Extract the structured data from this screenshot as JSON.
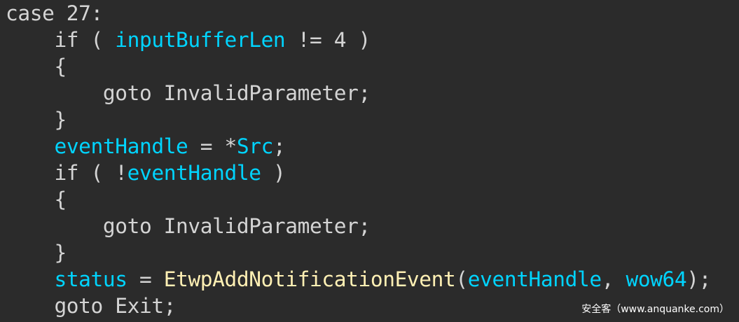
{
  "colors": {
    "background": "#2b2b2b",
    "default": "#d4d4d4",
    "keyword": "#c0c0c0",
    "identifier": "#00d4ff",
    "function": "#fff0b4",
    "watermark": "#ffffff"
  },
  "code": {
    "lines": [
      [
        {
          "t": "case 27:",
          "c": "default"
        }
      ],
      [
        {
          "t": "    if ( ",
          "c": "default"
        },
        {
          "t": "inputBufferLen",
          "c": "identifier"
        },
        {
          "t": " != 4 )",
          "c": "default"
        }
      ],
      [
        {
          "t": "    {",
          "c": "default"
        }
      ],
      [
        {
          "t": "        goto InvalidParameter;",
          "c": "default"
        }
      ],
      [
        {
          "t": "    }",
          "c": "default"
        }
      ],
      [
        {
          "t": "    ",
          "c": "default"
        },
        {
          "t": "eventHandle",
          "c": "identifier"
        },
        {
          "t": " = *",
          "c": "default"
        },
        {
          "t": "Src",
          "c": "identifier"
        },
        {
          "t": ";",
          "c": "default"
        }
      ],
      [
        {
          "t": "    if ( !",
          "c": "default"
        },
        {
          "t": "eventHandle",
          "c": "identifier"
        },
        {
          "t": " )",
          "c": "default"
        }
      ],
      [
        {
          "t": "    {",
          "c": "default"
        }
      ],
      [
        {
          "t": "        goto InvalidParameter;",
          "c": "default"
        }
      ],
      [
        {
          "t": "    }",
          "c": "default"
        }
      ],
      [
        {
          "t": "    ",
          "c": "default"
        },
        {
          "t": "status",
          "c": "identifier"
        },
        {
          "t": " = ",
          "c": "default"
        },
        {
          "t": "EtwpAddNotificationEvent",
          "c": "function"
        },
        {
          "t": "(",
          "c": "default"
        },
        {
          "t": "eventHandle",
          "c": "identifier"
        },
        {
          "t": ", ",
          "c": "default"
        },
        {
          "t": "wow64",
          "c": "identifier"
        },
        {
          "t": ");",
          "c": "default"
        }
      ],
      [
        {
          "t": "    goto Exit;",
          "c": "default"
        }
      ]
    ]
  },
  "watermark": {
    "text": "安全客（www.anquanke.com）"
  }
}
